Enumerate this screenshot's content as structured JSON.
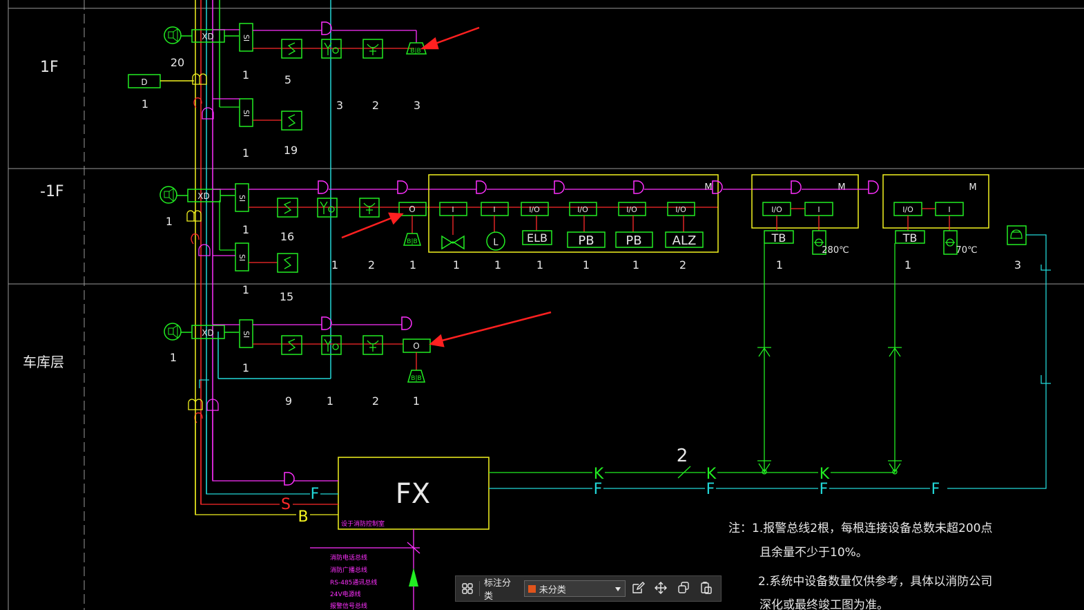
{
  "colors": {
    "background": "#000000",
    "grid": "#9a9a9a",
    "magenta": "#ff30ff",
    "green": "#22ee22",
    "red": "#ff2a2a",
    "yellow": "#f4f420",
    "cyan": "#22d8d8",
    "white": "#e8e8e8",
    "arrow": "#ff2020",
    "swatch_uncategorized": "#e0541c"
  },
  "floors": {
    "f1": "1F",
    "b1": "-1F",
    "garage": "车库层"
  },
  "floor1": {
    "xd": "XD",
    "si_a": "SI",
    "si_b": "SI",
    "d_box": "D",
    "n_speaker": "20",
    "n_d": "1",
    "n_si_a": "1",
    "n_si_b": "1",
    "n_s_a": "5",
    "n_s_b": "19",
    "n_smoke": "3",
    "n_manual": "2",
    "n_hydrant": "3"
  },
  "floorB1": {
    "xd": "XD",
    "si_a": "SI",
    "si_b": "SI",
    "o_box": "O",
    "n_speaker": "1",
    "n_si_a": "1",
    "n_si_b": "1",
    "n_s_a": "16",
    "n_s_b": "15",
    "n_smoke": "1",
    "n_manual": "2",
    "n_o": "1",
    "module_m": "M",
    "mod_labels": [
      "I",
      "I",
      "I/O",
      "I/O",
      "I/O",
      "I/O"
    ],
    "mod_devices": [
      "",
      "L",
      "ELB",
      "PB",
      "PB",
      "ALZ"
    ],
    "mod_counts": [
      "1",
      "1",
      "1",
      "1",
      "1",
      "2"
    ],
    "pump1": {
      "m": "M",
      "io": "I/O",
      "i": "I",
      "tb": "TB",
      "temp": "280℃",
      "count": "1"
    },
    "pump2": {
      "m": "M",
      "io": "I/O",
      "i": "I",
      "tb": "TB",
      "temp": "70℃",
      "count": "1"
    },
    "phone_count": "3"
  },
  "garage": {
    "xd": "XD",
    "si": "SI",
    "o_box": "O",
    "n_speaker": "1",
    "n_si": "1",
    "n_s": "9",
    "n_smoke": "1",
    "n_manual": "2",
    "n_o": "1"
  },
  "panel": {
    "label": "FX",
    "sublabel": "设于消防控制室",
    "bus_d": "D",
    "bus_f": "F",
    "bus_s": "S",
    "bus_b": "B",
    "k_labels": [
      "K",
      "K",
      "K"
    ],
    "f_labels": [
      "F",
      "F",
      "F",
      "F"
    ],
    "wire_count": "2"
  },
  "legend": [
    "消防电话总线",
    "消防广播总线",
    "RS-485通讯总线",
    "24V电源线",
    "报警信号总线"
  ],
  "notes": {
    "line1": "注：1.报警总线2根，每根连接设备总数未超200点",
    "line2": "且余量不少于10%。",
    "line3": "2.系统中设备数量仅供参考，具体以消防公司",
    "line4": "深化或最终竣工图为准。"
  },
  "toolbar": {
    "category_label": "标注分类",
    "category_value": "未分类",
    "icons": [
      "grid-icon",
      "chevron-down-icon",
      "edit-icon",
      "move-icon",
      "copy-icon",
      "paste-icon"
    ]
  }
}
